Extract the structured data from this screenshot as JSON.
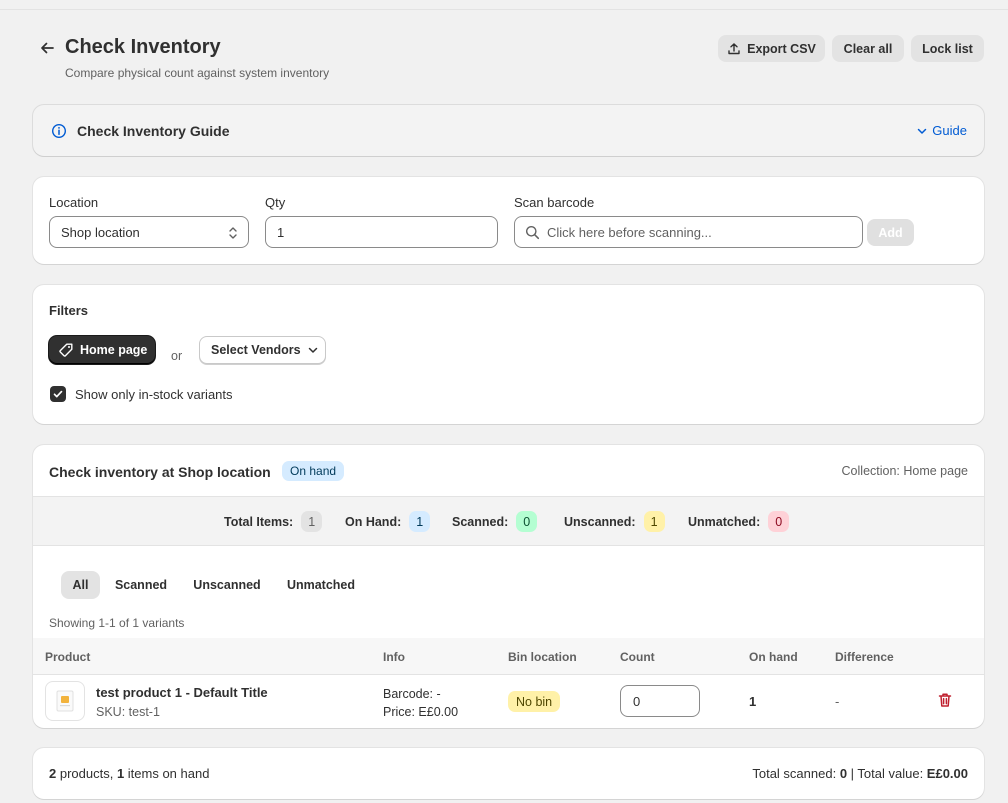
{
  "header": {
    "title": "Check Inventory",
    "subtitle": "Compare physical count against system inventory",
    "export_label": "Export CSV",
    "clear_label": "Clear all",
    "lock_label": "Lock list"
  },
  "guide": {
    "title": "Check Inventory Guide",
    "link_label": "Guide"
  },
  "form": {
    "location_label": "Location",
    "location_value": "Shop location",
    "qty_label": "Qty",
    "qty_value": "1",
    "scan_label": "Scan barcode",
    "scan_placeholder": "Click here before scanning...",
    "add_label": "Add"
  },
  "filters": {
    "title": "Filters",
    "collection_tag": "Home page",
    "or_text": "or",
    "vendor_label": "Select Vendors",
    "instock_label": "Show only in-stock variants",
    "instock_checked": true
  },
  "inventory": {
    "title": "Check inventory at Shop location",
    "status_badge": "On hand",
    "collection_text": "Collection: Home page",
    "stats": [
      {
        "label": "Total Items:",
        "value": "1",
        "color": "#e3e3e3"
      },
      {
        "label": "On Hand:",
        "value": "1",
        "color": "#d5ebff"
      },
      {
        "label": "Scanned:",
        "value": "0",
        "color": "#b4fed2"
      },
      {
        "label": "Unscanned:",
        "value": "1",
        "color": "#fff1a8"
      },
      {
        "label": "Unmatched:",
        "value": "0",
        "color": "#fed1d7"
      }
    ],
    "tabs": [
      "All",
      "Scanned",
      "Unscanned",
      "Unmatched"
    ],
    "showing": "Showing 1-1 of 1 variants",
    "columns": [
      "Product",
      "Info",
      "Bin location",
      "Count",
      "On hand",
      "Difference"
    ],
    "rows": [
      {
        "name": "test product 1 - Default Title",
        "sku": "SKU: test-1",
        "barcode": "Barcode: -",
        "price": "Price: E£0.00",
        "bin": "No bin",
        "count": "0",
        "on_hand": "1",
        "difference": "-"
      }
    ]
  },
  "footer": {
    "products_count": "2",
    "products_text": " products, ",
    "items_count": "1",
    "items_text": " items on hand",
    "scanned_label": "Total scanned: ",
    "scanned_value": "0",
    "separator": " | ",
    "value_label": "Total value: ",
    "value_value": "E£0.00"
  }
}
